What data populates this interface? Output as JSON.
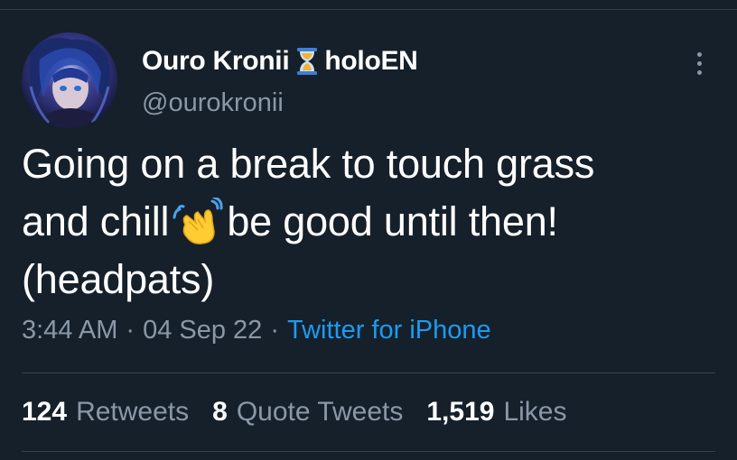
{
  "tweet": {
    "display_name": "Ouro Kronii",
    "affiliation": "holoEN",
    "name_icon": "hourglass-icon",
    "handle": "@ourokronii",
    "text_lines": [
      "Going on a break to touch grass",
      "be good until then!",
      "(headpats)"
    ],
    "text_line2_prefix": "and chill",
    "inline_emoji": "waving-hand-icon",
    "time": "3:44 AM",
    "date": "04 Sep 22",
    "separator": "·",
    "source": "Twitter for iPhone"
  },
  "stats": {
    "retweets_count": "124",
    "retweets_label": "Retweets",
    "quotes_count": "8",
    "quotes_label": "Quote Tweets",
    "likes_count": "1,519",
    "likes_label": "Likes"
  },
  "colors": {
    "background": "#15202b",
    "text_primary": "#ffffff",
    "text_secondary": "#8b98a5",
    "link": "#1d9bf0",
    "divider": "#38444d"
  }
}
